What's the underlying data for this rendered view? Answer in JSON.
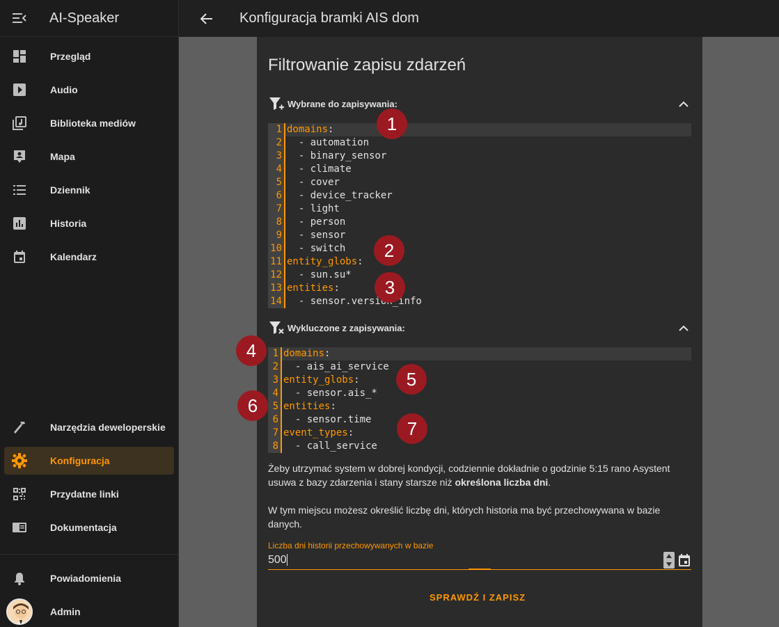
{
  "sidebar": {
    "app_title": "AI-Speaker",
    "items": [
      {
        "label": "Przegląd",
        "icon": "dashboard-icon"
      },
      {
        "label": "Audio",
        "icon": "play-box-icon"
      },
      {
        "label": "Biblioteka mediów",
        "icon": "music-library-icon"
      },
      {
        "label": "Mapa",
        "icon": "map-account-icon"
      },
      {
        "label": "Dziennik",
        "icon": "list-icon"
      },
      {
        "label": "Historia",
        "icon": "chart-box-icon"
      },
      {
        "label": "Kalendarz",
        "icon": "calendar-icon"
      }
    ],
    "bottom_items": [
      {
        "label": "Narzędzia deweloperskie",
        "icon": "hammer-icon"
      },
      {
        "label": "Konfiguracja",
        "icon": "cog-icon",
        "active": true
      },
      {
        "label": "Przydatne linki",
        "icon": "qrcode-icon"
      },
      {
        "label": "Dokumentacja",
        "icon": "book-icon"
      }
    ],
    "notifications_label": "Powiadomienia",
    "user_label": "Admin"
  },
  "topbar": {
    "title": "Konfiguracja bramki AIS dom"
  },
  "card": {
    "title": "Filtrowanie zapisu zdarzeń",
    "included": {
      "header": "Wybrane do zapisywania:",
      "lines": [
        {
          "n": "1",
          "key": "domains",
          "rest": ":"
        },
        {
          "n": "2",
          "text": "  - automation"
        },
        {
          "n": "3",
          "text": "  - binary_sensor"
        },
        {
          "n": "4",
          "text": "  - climate"
        },
        {
          "n": "5",
          "text": "  - cover"
        },
        {
          "n": "6",
          "text": "  - device_tracker"
        },
        {
          "n": "7",
          "text": "  - light"
        },
        {
          "n": "8",
          "text": "  - person"
        },
        {
          "n": "9",
          "text": "  - sensor"
        },
        {
          "n": "10",
          "text": "  - switch"
        },
        {
          "n": "11",
          "key": "entity_globs",
          "rest": ":"
        },
        {
          "n": "12",
          "text": "  - sun.su*"
        },
        {
          "n": "13",
          "key": "entities",
          "rest": ":"
        },
        {
          "n": "14",
          "text": "  - sensor.version_info"
        }
      ]
    },
    "excluded": {
      "header": "Wykluczone z zapisywania:",
      "lines": [
        {
          "n": "1",
          "key": "domains",
          "rest": ":"
        },
        {
          "n": "2",
          "text": "  - ais_ai_service"
        },
        {
          "n": "3",
          "key": "entity_globs",
          "rest": ":"
        },
        {
          "n": "4",
          "text": "  - sensor.ais_*"
        },
        {
          "n": "5",
          "key": "entities",
          "rest": ":"
        },
        {
          "n": "6",
          "text": "  - sensor.time"
        },
        {
          "n": "7",
          "key": "event_types",
          "rest": ":"
        },
        {
          "n": "8",
          "text": "  - call_service"
        }
      ]
    },
    "paragraph1_a": "Żeby utrzymać system w dobrej kondycji, codziennie dokładnie o godzinie 5:15 rano Asystent usuwa z bazy zdarzenia i stany starsze niż ",
    "paragraph1_bold": "określona liczba dni",
    "paragraph1_b": ".",
    "paragraph2": "W tym miejscu możesz określić liczbę dni, których historia ma być przechowywana w bazie danych.",
    "field_label": "Liczba dni historii przechowywanych w bazie",
    "field_value": "500",
    "action_button": "SPRAWDŹ I ZAPISZ"
  },
  "markers": [
    "1",
    "2",
    "3",
    "4",
    "5",
    "6",
    "7"
  ],
  "colors": {
    "accent": "#ff9800",
    "marker": "#9b1a22",
    "sidebar_bg": "#1c1c1c",
    "card_bg": "#2b2b2b",
    "content_bg": "#5f5f5f"
  }
}
